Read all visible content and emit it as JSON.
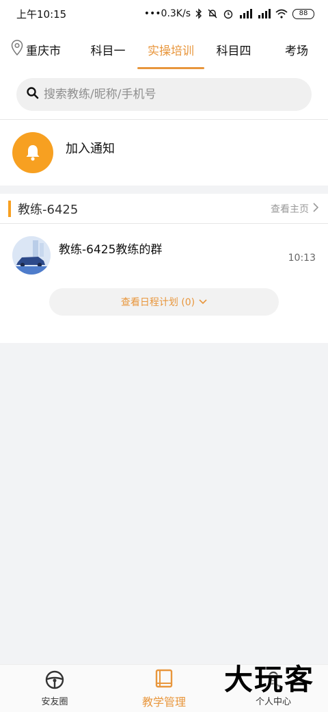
{
  "status": {
    "time": "上午10:15",
    "net_speed": "•••0.3K/s",
    "battery": "88"
  },
  "tabs": {
    "city": "重庆市",
    "items": [
      "科目一",
      "实操培训",
      "科目四",
      "考场"
    ],
    "active_index": 1
  },
  "search": {
    "placeholder": "搜索教练/昵称/手机号"
  },
  "notice": {
    "label": "加入通知"
  },
  "coach": {
    "title": "教练-6425",
    "home_link": "查看主页",
    "group": {
      "name": "教练-6425教练的群",
      "time": "10:13"
    },
    "schedule_button": "查看日程计划 (0)"
  },
  "bottom_nav": {
    "items": [
      {
        "label": "安友圈",
        "icon": "steering-wheel-icon"
      },
      {
        "label": "教学管理",
        "icon": "book-icon"
      },
      {
        "label": "个人中心",
        "icon": "user-icon"
      }
    ],
    "active_index": 1
  },
  "watermark": "大玩客",
  "colors": {
    "accent": "#e8963c",
    "bell": "#f7a021"
  }
}
